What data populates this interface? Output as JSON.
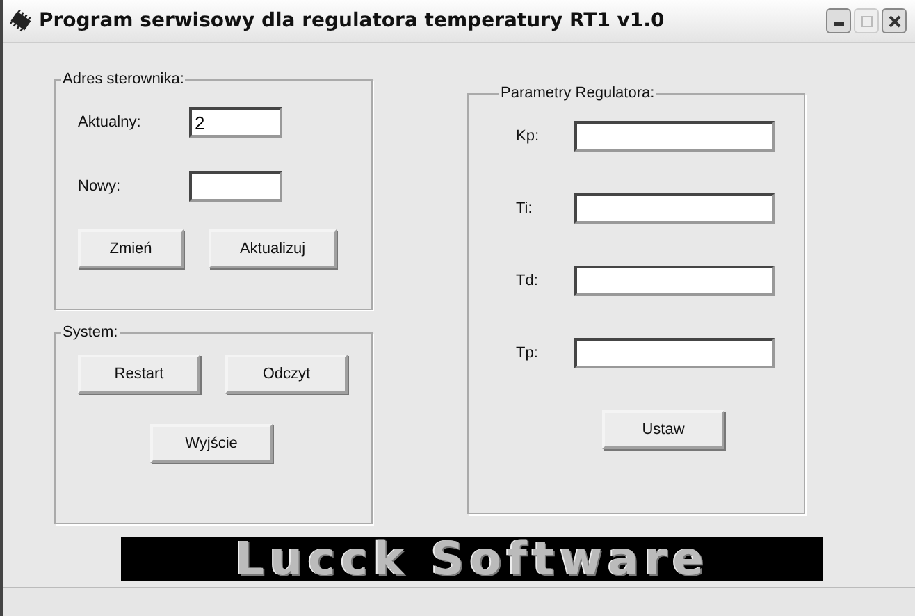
{
  "window": {
    "title": "Program serwisowy dla regulatora temperatury RT1 v1.0"
  },
  "address_group": {
    "title": "Adres sterownika:",
    "fields": [
      {
        "label": "Aktualny:",
        "value": "2"
      },
      {
        "label": "Nowy:"
      }
    ],
    "buttons": [
      "Zmień",
      "Aktualizuj"
    ]
  },
  "system_group": {
    "title": "System:",
    "buttons": [
      "Restart",
      "Odczyt"
    ],
    "exit_button": "Wyjście"
  },
  "parameters_group": {
    "title": "Parametry Regulatora:",
    "fields": [
      {
        "label": "Kp:"
      },
      {
        "label": "Ti:"
      },
      {
        "label": "Td:"
      },
      {
        "label": "Tp:"
      }
    ],
    "button": "Ustaw"
  },
  "logo": "Lucck Software"
}
